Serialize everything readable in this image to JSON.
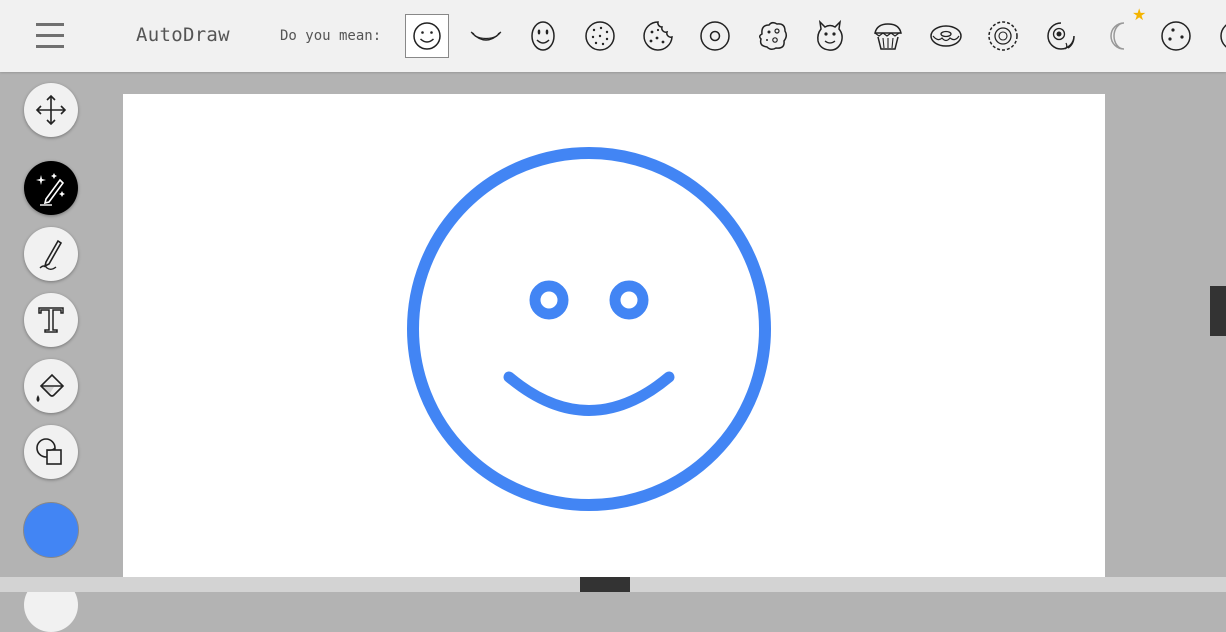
{
  "app": {
    "title": "AutoDraw"
  },
  "header": {
    "menu_icon": "hamburger-menu-icon",
    "suggestions_label": "Do you mean:",
    "suggestions": [
      {
        "icon": "smiley-face-icon",
        "selected": true
      },
      {
        "icon": "smile-mouth-icon",
        "selected": false
      },
      {
        "icon": "happy-oval-face-icon",
        "selected": false
      },
      {
        "icon": "dotted-circle-icon",
        "selected": false
      },
      {
        "icon": "cookie-icon",
        "selected": false
      },
      {
        "icon": "ring-icon",
        "selected": false
      },
      {
        "icon": "blob-creature-icon",
        "selected": false
      },
      {
        "icon": "creature-face-icon",
        "selected": false
      },
      {
        "icon": "cupcake-icon",
        "selected": false
      },
      {
        "icon": "donut-icon",
        "selected": false
      },
      {
        "icon": "sunflower-icon",
        "selected": false
      },
      {
        "icon": "eye-face-icon",
        "selected": false
      },
      {
        "icon": "crescent-moon-icon",
        "selected": false
      },
      {
        "icon": "face-dots-icon",
        "selected": false
      },
      {
        "icon": "partial-suggestion-icon",
        "selected": false
      }
    ],
    "featured_star_icon": "star-icon"
  },
  "sidebar": {
    "tools": [
      {
        "name": "select-tool",
        "icon": "move-arrows-icon",
        "active": false
      },
      {
        "name": "autodraw-tool",
        "icon": "magic-pencil-icon",
        "active": true
      },
      {
        "name": "draw-tool",
        "icon": "pencil-icon",
        "active": false
      },
      {
        "name": "type-tool",
        "icon": "text-t-icon",
        "active": false
      },
      {
        "name": "fill-tool",
        "icon": "paint-bucket-icon",
        "active": false
      },
      {
        "name": "shape-tool",
        "icon": "shapes-icon",
        "active": false
      },
      {
        "name": "color-picker",
        "icon": "color-swatch-icon",
        "active": false
      }
    ],
    "current_color": "#4285f4"
  },
  "canvas": {
    "drawing": "smiley-face",
    "stroke_color": "#4285f4"
  },
  "colors": {
    "toolbar_bg": "#f1f1f1",
    "workspace_bg": "#b3b3b3",
    "accent_blue": "#4285f4",
    "star_yellow": "#f4b400"
  }
}
